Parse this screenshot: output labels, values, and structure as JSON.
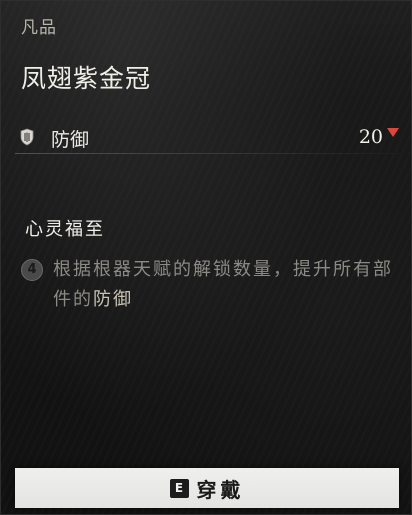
{
  "item": {
    "rarity": "凡品",
    "name": "凤翅紫金冠"
  },
  "stat": {
    "icon": "defense-shield-icon",
    "label": "防御",
    "value": "20",
    "change_direction": "down",
    "change_color": "#e0463a"
  },
  "skill": {
    "title": "心灵福至",
    "level": "4",
    "desc_part1": "根据根器天赋的解锁数量，提升所有部件的",
    "desc_highlight": "防御"
  },
  "action": {
    "key": "E",
    "label": "穿戴"
  }
}
